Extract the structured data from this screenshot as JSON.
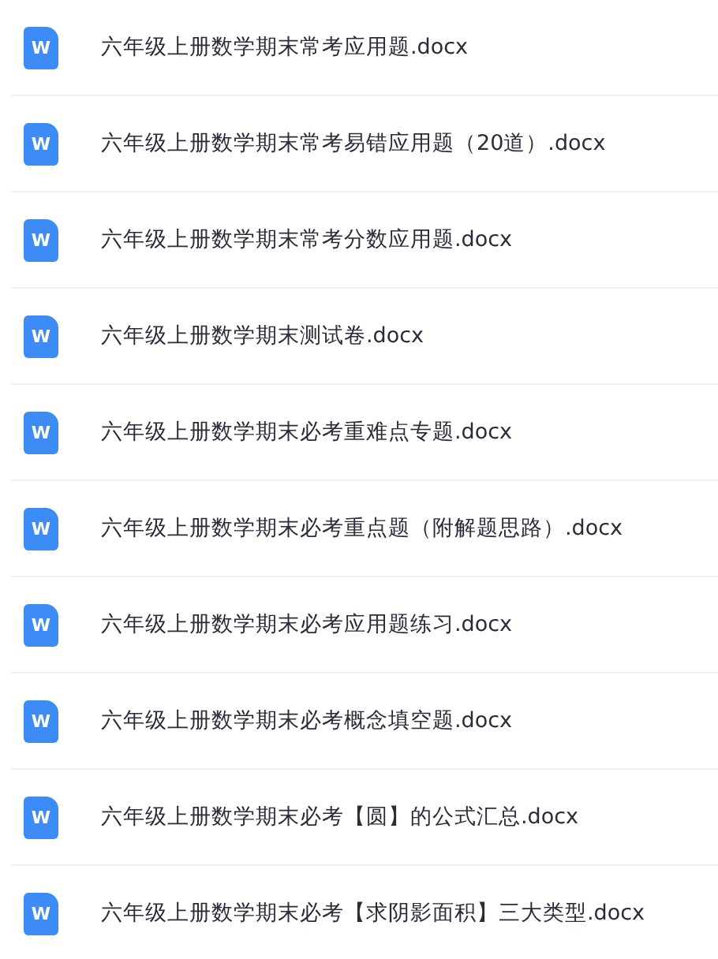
{
  "files": [
    {
      "icon_letter": "W",
      "name": "六年级上册数学期末常考应用题.docx"
    },
    {
      "icon_letter": "W",
      "name": "六年级上册数学期末常考易错应用题（20道）.docx"
    },
    {
      "icon_letter": "W",
      "name": "六年级上册数学期末常考分数应用题.docx"
    },
    {
      "icon_letter": "W",
      "name": "六年级上册数学期末测试卷.docx"
    },
    {
      "icon_letter": "W",
      "name": "六年级上册数学期末必考重难点专题.docx"
    },
    {
      "icon_letter": "W",
      "name": "六年级上册数学期末必考重点题（附解题思路）.docx"
    },
    {
      "icon_letter": "W",
      "name": "六年级上册数学期末必考应用题练习.docx"
    },
    {
      "icon_letter": "W",
      "name": "六年级上册数学期末必考概念填空题.docx"
    },
    {
      "icon_letter": "W",
      "name": "六年级上册数学期末必考【圆】的公式汇总.docx"
    },
    {
      "icon_letter": "W",
      "name": "六年级上册数学期末必考【求阴影面积】三大类型.docx"
    }
  ]
}
